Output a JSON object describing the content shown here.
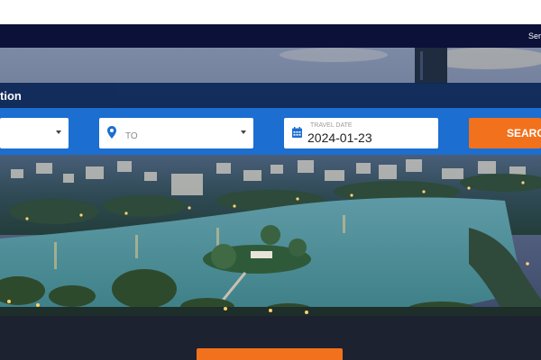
{
  "topbar": {
    "link_label": "Ser"
  },
  "hero": {
    "image_description": ""
  },
  "section": {
    "title": "tion"
  },
  "search": {
    "from": {
      "value": ""
    },
    "to": {
      "placeholder": "TO"
    },
    "date": {
      "caption": "TRAVEL DATE",
      "value": "2024-01-23"
    },
    "button_label": "SEARCH"
  },
  "colors": {
    "navy": "#0b1138",
    "panel_blue": "#1c6ed0",
    "accent_orange": "#f2711c",
    "footer": "#1d2230"
  },
  "icons": {
    "to": "map-pin-icon",
    "date": "calendar-icon",
    "dropdown": "chevron-down-icon"
  }
}
